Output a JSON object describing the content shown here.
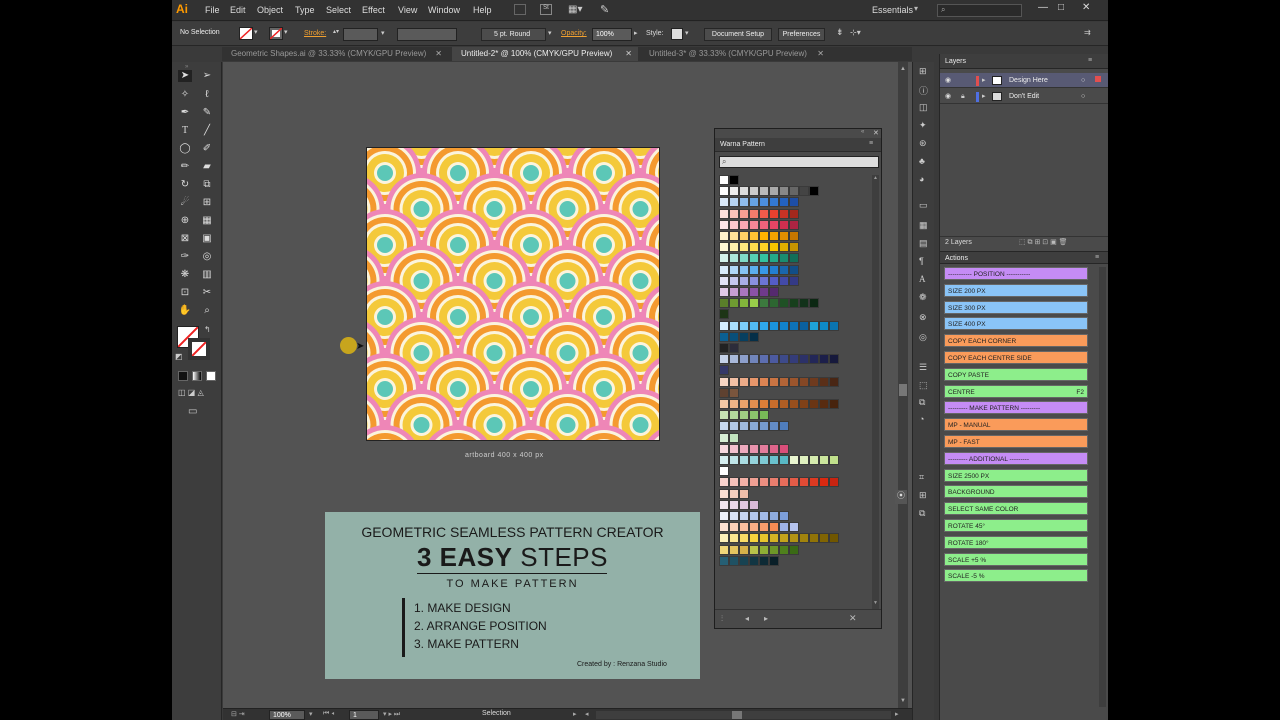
{
  "menubar": {
    "logo": "Ai",
    "items": [
      "File",
      "Edit",
      "Object",
      "Type",
      "Select",
      "Effect",
      "View",
      "Window",
      "Help"
    ],
    "workspace": "Essentials",
    "window_controls": [
      "—",
      "□",
      "✕"
    ]
  },
  "control_bar": {
    "selection_label": "No Selection",
    "stroke_label": "Stroke:",
    "brush": "5 pt. Round",
    "opacity_label": "Opacity:",
    "opacity_value": "100%",
    "style_label": "Style:",
    "document_setup": "Document Setup",
    "preferences": "Preferences"
  },
  "tabs": [
    {
      "label": "Geometric Shapes.ai @ 33.33% (CMYK/GPU Preview)"
    },
    {
      "label": "Untitled-2* @ 100% (CMYK/GPU Preview)"
    },
    {
      "label": "Untitled-3* @ 33.33% (CMYK/GPU Preview)"
    }
  ],
  "artboard": {
    "caption": "artboard 400 x 400 px",
    "colors": {
      "pink": "#ee86b7",
      "orange": "#f49a2f",
      "yellow": "#f4c93a",
      "teal": "#5cc7b7",
      "white": "#fbf4dd"
    }
  },
  "info_card": {
    "title": "GEOMETRIC SEAMLESS PATTERN CREATOR",
    "big_bold": "3 EASY",
    "big_light": "STEPS",
    "subtitle": "TO MAKE PATTERN",
    "steps": [
      "1. MAKE DESIGN",
      "2. ARRANGE POSITION",
      "3. MAKE PATTERN"
    ],
    "credit": "Created by : Renzana Studio"
  },
  "swatch_panel": {
    "title": "Warna Pattern",
    "rows": [
      [
        "#ffffff",
        "#000000"
      ],
      [
        "#ffffff",
        "#eeeeee",
        "#dddddd",
        "#cccccc",
        "#bbbbbb",
        "#aaaaaa",
        "#888888",
        "#666666",
        "#444444",
        "#000000"
      ],
      [
        "#dbe9f8",
        "#b7d4f2",
        "#8fbcec",
        "#66a3e4",
        "#4c8fde",
        "#3379d3",
        "#2362c0",
        "#1d4ea6"
      ],
      [
        "#fde0dc",
        "#fbc2b9",
        "#f8a093",
        "#f57c6c",
        "#f25b4b",
        "#e8412f",
        "#c83325",
        "#a3281d"
      ],
      [
        "#fde6e8",
        "#fcc9ce",
        "#f9a8b2",
        "#f48696",
        "#ee637b",
        "#e64564",
        "#cf2f4f",
        "#ad2442"
      ],
      [
        "#fff2cc",
        "#ffe399",
        "#ffd166",
        "#ffc233",
        "#ffb300",
        "#f5a300",
        "#e08e00",
        "#c77600"
      ],
      [
        "#fff9d6",
        "#fff2ad",
        "#ffe97f",
        "#ffdd4d",
        "#ffd226",
        "#f7c500",
        "#e0ae00",
        "#c69400"
      ],
      [
        "#d5f3ec",
        "#abe7da",
        "#80dbc7",
        "#56cfb4",
        "#33c2a0",
        "#23a989",
        "#1a8c70",
        "#116e58"
      ],
      [
        "#d9ecfb",
        "#b0d8f7",
        "#86c3f3",
        "#5caeee",
        "#3899e8",
        "#237fd1",
        "#1a66ad",
        "#124e87"
      ],
      [
        "#e3e4f7",
        "#c6c9ef",
        "#a8ade7",
        "#8a91df",
        "#6c75d6",
        "#545dc6",
        "#434aa8",
        "#343a86"
      ],
      [
        "#e0c8e6",
        "#c89fd2",
        "#a976bd",
        "#8a52a6",
        "#6f3a8c",
        "#552a6f"
      ],
      [
        "#5a7f2a",
        "#6e9b31",
        "#82b53b",
        "#99cc4a",
        "#3c7a3e",
        "#2d6631",
        "#1f5125",
        "#173f1c",
        "#12321a",
        "#0c2813"
      ],
      [
        "#1d3516"
      ],
      [
        "#d5efff",
        "#a9dffd",
        "#7ccdf9",
        "#52bbf3",
        "#2fa8ec",
        "#1b94de",
        "#1182cc",
        "#0d72b8",
        "#0a60a0",
        "#1ea2d9",
        "#0e8ac7",
        "#0a74b0"
      ],
      [
        "#0b5f92",
        "#094f79",
        "#073f60",
        "#052f48"
      ],
      [
        "#222222",
        "#2c2c3a"
      ],
      [
        "#c5d2e8",
        "#a9b9d9",
        "#8d9fcb",
        "#7185bb",
        "#5d6eb0",
        "#4c5aa0",
        "#3d4a8a",
        "#343c79",
        "#2c3168",
        "#232758",
        "#1c1f4a",
        "#16193c"
      ],
      [
        "#343868"
      ],
      [
        "#f6d5c3",
        "#f1c0a5",
        "#ecab88",
        "#e6966b",
        "#dc8453",
        "#c97443",
        "#b26437",
        "#9b552d",
        "#844725",
        "#6e3a1e",
        "#5a2f18",
        "#492614"
      ],
      [
        "#5e4130",
        "#7a553d"
      ],
      [
        "#f3c8a4",
        "#eeb587",
        "#e9a26b",
        "#e38f50",
        "#dc7e38",
        "#c86d2c",
        "#b05e24",
        "#984f1d",
        "#804118",
        "#6a3514",
        "#582b10",
        "#47230d"
      ],
      [
        "#c7e3b5",
        "#b3d99c",
        "#9fce84",
        "#8bc46c",
        "#78b957"
      ],
      [
        "#c7d8ee",
        "#b3c9e6",
        "#9fbade",
        "#8aaad5",
        "#769bcd",
        "#638cc5",
        "#4f7dbc"
      ],
      [
        "#d7eed5",
        "#c3e5c0"
      ],
      [
        "#f7d9e0",
        "#f2c1cf",
        "#edaabe",
        "#e893ad",
        "#e37c9c",
        "#de658b",
        "#d94e7a"
      ],
      [
        "#d6eef0",
        "#c0e5e9",
        "#aadce2",
        "#95d3db",
        "#7fcad4",
        "#6ac1cd",
        "#58b8c5",
        "#e9f5d0",
        "#dff0bf",
        "#d5ebae",
        "#cbe69d",
        "#c1e18c"
      ],
      [
        "#ffffff"
      ],
      [
        "#f8d3cd",
        "#f5c2ba",
        "#f2b1a7",
        "#efa094",
        "#ec8f81",
        "#e97e6e",
        "#e66d5b",
        "#e35c48",
        "#e04b35",
        "#dd3a22",
        "#da2910",
        "#c82410"
      ],
      [
        "#f9dfd4",
        "#f5cfbf",
        "#f1bfaa"
      ],
      [
        "#f1e6ef",
        "#e9d7e7",
        "#e1c8df",
        "#d9b9d7"
      ],
      [
        "#eef2fb",
        "#dbe4f6",
        "#c8d6f1",
        "#b5c8ec",
        "#a2bae7",
        "#8facde",
        "#7c9ed9"
      ],
      [
        "#fde2d2",
        "#fcd1b9",
        "#fbc09f",
        "#f9ae86",
        "#f89d6c",
        "#f78c53",
        "#9fb3e8",
        "#b6c4ee"
      ],
      [
        "#fdf0b9",
        "#fbe690",
        "#f9dc66",
        "#f7d23d",
        "#e8c52d",
        "#d6b324",
        "#c4a31c",
        "#b29314",
        "#a1830d",
        "#907307",
        "#806403",
        "#705600"
      ],
      [
        "#f0d67a",
        "#e3c460",
        "#d5b14a",
        "#b9c24a",
        "#8fae35",
        "#6d9728",
        "#4f801d",
        "#3a6a15"
      ],
      [
        "#265f74",
        "#1f5163",
        "#184352",
        "#123643",
        "#0d2a35",
        "#091f28"
      ]
    ]
  },
  "layers_panel": {
    "title": "Layers",
    "layers": [
      "Design Here",
      "Don't Edit"
    ],
    "count": "2 Layers"
  },
  "actions_panel": {
    "title": "Actions",
    "items": [
      {
        "label": "----------- POSITION -----------",
        "color": "pink"
      },
      {
        "label": "SIZE 200 PX",
        "color": "blue"
      },
      {
        "label": "SIZE 300 PX",
        "color": "blue"
      },
      {
        "label": "SIZE 400 PX",
        "color": "blue"
      },
      {
        "label": "COPY EACH CORNER",
        "color": "orange"
      },
      {
        "label": "COPY EACH CENTRE SIDE",
        "color": "orange"
      },
      {
        "label": "COPY PASTE",
        "color": "green"
      },
      {
        "label": "CENTRE",
        "color": "green",
        "key": "F2"
      },
      {
        "label": "--------- MAKE PATTERN ---------",
        "color": "pink"
      },
      {
        "label": "MP - MANUAL",
        "color": "orange"
      },
      {
        "label": "MP - FAST",
        "color": "orange"
      },
      {
        "label": "--------- ADDITIONAL ---------",
        "color": "pink"
      },
      {
        "label": "SIZE 2500 PX",
        "color": "green"
      },
      {
        "label": "BACKGROUND",
        "color": "green"
      },
      {
        "label": "SELECT SAME COLOR",
        "color": "green"
      },
      {
        "label": "ROTATE 45°",
        "color": "green"
      },
      {
        "label": "ROTATE 180°",
        "color": "green"
      },
      {
        "label": "SCALE +5 %",
        "color": "green"
      },
      {
        "label": "SCALE -5 %",
        "color": "green"
      }
    ]
  },
  "status_bar": {
    "zoom": "100%",
    "artboard_num": "1",
    "status": "Selection"
  }
}
